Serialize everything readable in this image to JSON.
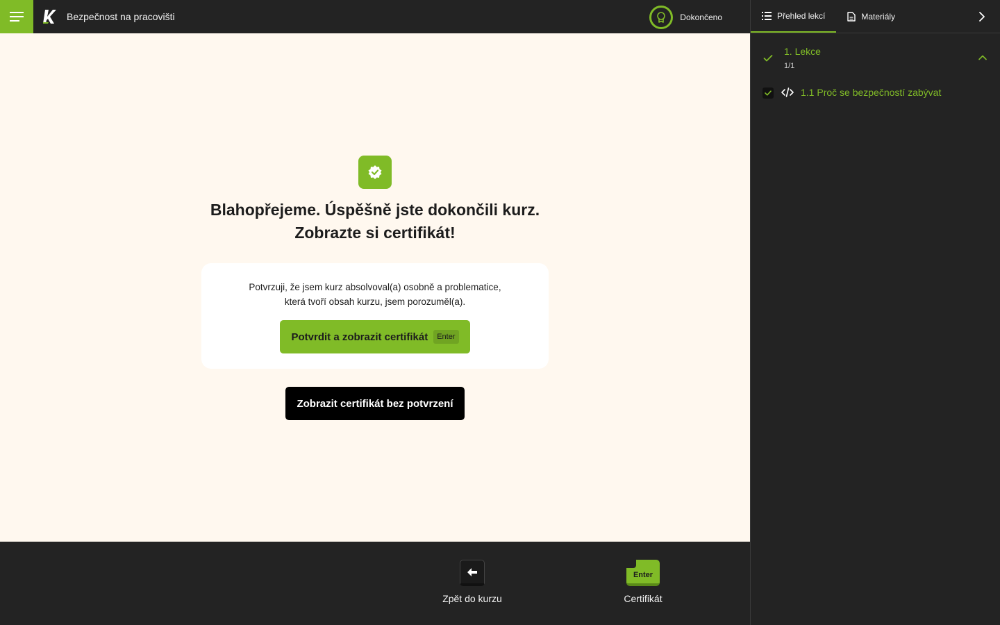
{
  "header": {
    "course_title": "Bezpečnost na pracovišti",
    "status_label": "Dokončeno"
  },
  "main": {
    "headline_line1": "Blahopřejeme. Úspěšně jste dokončili kurz.",
    "headline_line2": "Zobrazte si certifikát!",
    "confirm_text_line1": "Potvrzuji, že jsem kurz absolvoval(a) osobně a problematice,",
    "confirm_text_line2": "která tvoří obsah kurzu, jsem porozuměl(a).",
    "confirm_button_label": "Potvrdit a zobrazit certifikát",
    "confirm_button_shortcut": "Enter",
    "plain_button_label": "Zobrazit certifikát bez potvrzení"
  },
  "footer": {
    "back_label": "Zpět do kurzu",
    "next_key": "Enter",
    "next_label": "Certifikát"
  },
  "sidebar": {
    "tabs": [
      {
        "label": "Přehled lekcí",
        "icon": "list-icon",
        "active": true
      },
      {
        "label": "Materiály",
        "icon": "document-icon",
        "active": false
      }
    ],
    "lessons": [
      {
        "title": "1. Lekce",
        "progress": "1/1",
        "completed": true,
        "items": [
          {
            "label": "1.1 Proč se bezpečností zabývat",
            "icon": "code-icon",
            "completed": true
          }
        ]
      }
    ]
  },
  "colors": {
    "accent": "#80bb27",
    "dark": "#232323",
    "page": "#fff8ef"
  }
}
